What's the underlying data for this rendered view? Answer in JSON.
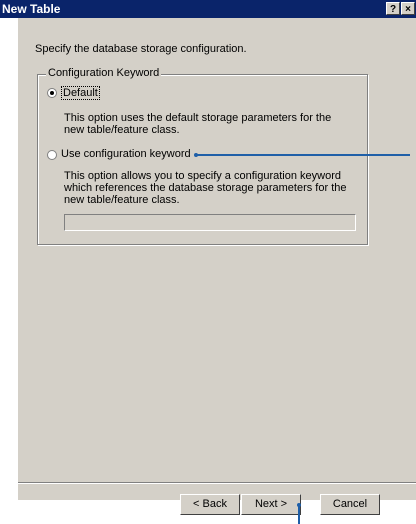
{
  "window": {
    "title": "New Table",
    "help_label": "?",
    "close_label": "×"
  },
  "intro_text": "Specify the database storage configuration.",
  "group": {
    "legend": "Configuration Keyword",
    "default_option": {
      "label": "Default",
      "selected": true,
      "description": "This option uses the default storage parameters for the new table/feature class."
    },
    "keyword_option": {
      "label": "Use configuration keyword",
      "selected": false,
      "description": "This option allows you to specify a configuration keyword which references the database storage parameters for the new table/feature class.",
      "keyword_value": ""
    }
  },
  "buttons": {
    "back": "Back",
    "next": "Next",
    "cancel": "Cancel"
  },
  "colors": {
    "titlebar": "#0a246a",
    "dialog_face": "#d4d0c8",
    "callout": "#1f5fa8"
  }
}
